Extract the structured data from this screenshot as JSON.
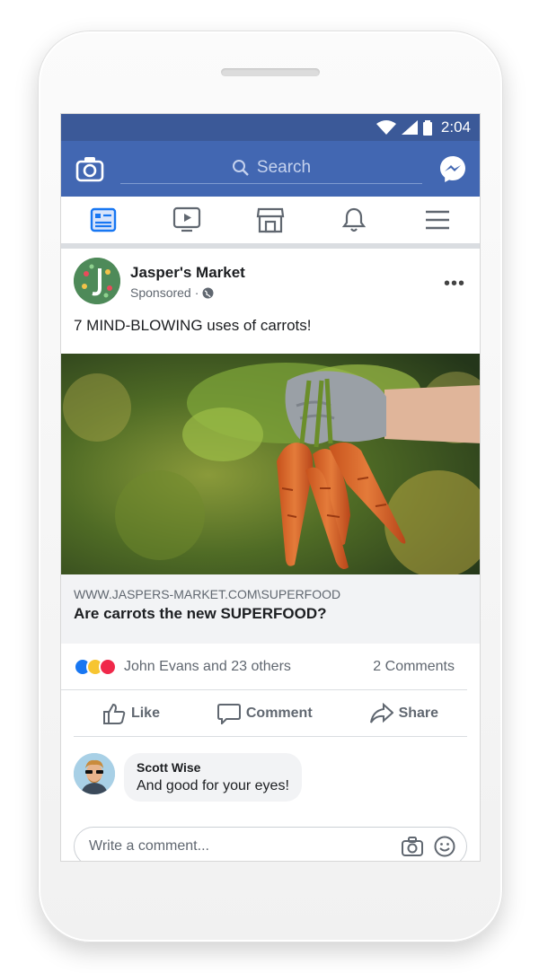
{
  "status": {
    "time": "2:04"
  },
  "appbar": {
    "search_placeholder": "Search"
  },
  "tabs": [
    "news-feed",
    "watch",
    "marketplace",
    "notifications",
    "menu"
  ],
  "post": {
    "page_name": "Jasper's Market",
    "sponsored": "Sponsored",
    "caption": "7 MIND-BLOWING uses of carrots!",
    "link_url": "WWW.JASPERS-MARKET.COM\\SUPERFOOD",
    "link_title": "Are carrots the new SUPERFOOD?",
    "reaction_names": "John Evans and 23 others",
    "comments_count": "2 Comments"
  },
  "actions": {
    "like": "Like",
    "comment": "Comment",
    "share": "Share"
  },
  "comment": {
    "author": "Scott Wise",
    "text": "And good for your eyes!"
  },
  "composer": {
    "placeholder": "Write a comment..."
  },
  "colors": {
    "brand": "#4267b2",
    "status": "#3b5998"
  }
}
